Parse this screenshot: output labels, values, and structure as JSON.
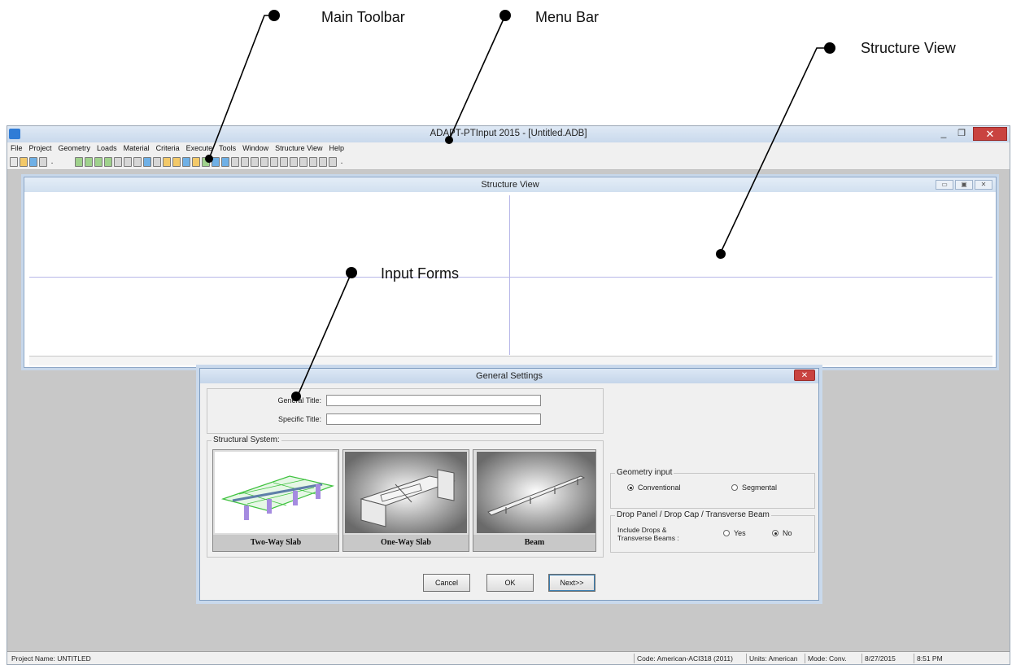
{
  "callouts": {
    "main_toolbar": "Main Toolbar",
    "menu_bar": "Menu Bar",
    "structure_view": "Structure View",
    "input_forms": "Input Forms"
  },
  "window": {
    "title": "ADAPT-PTInput 2015 - [Untitled.ADB]",
    "minimize": "_",
    "maximize": "❐",
    "close": "✕"
  },
  "menu": {
    "items": [
      "File",
      "Project",
      "Geometry",
      "Loads",
      "Material",
      "Criteria",
      "Execute",
      "Tools",
      "Window",
      "Structure View",
      "Help"
    ]
  },
  "structure_view": {
    "title": "Structure View"
  },
  "dialog": {
    "title": "General Settings",
    "close": "✕",
    "general_title_label": "General Title:",
    "general_title_value": "",
    "specific_title_label": "Specific Title:",
    "specific_title_value": "",
    "structural_system_label": "Structural System:",
    "systems": [
      "Two-Way Slab",
      "One-Way Slab",
      "Beam"
    ],
    "geometry_input": {
      "label": "Geometry input",
      "options": [
        "Conventional",
        "Segmental"
      ],
      "selected": "Conventional"
    },
    "drop_panel": {
      "label": "Drop Panel / Drop Cap / Transverse Beam",
      "question": "Include Drops & Transverse Beams :",
      "options": [
        "Yes",
        "No"
      ],
      "selected": "No"
    },
    "buttons": {
      "cancel": "Cancel",
      "ok": "OK",
      "next": "Next>>"
    }
  },
  "statusbar": {
    "project_name": "Project Name: UNTITLED",
    "code": "Code: American-ACI318 (2011)",
    "units": "Units: American",
    "mode": "Mode: Conv.",
    "date": "8/27/2015",
    "time": "8:51 PM"
  }
}
